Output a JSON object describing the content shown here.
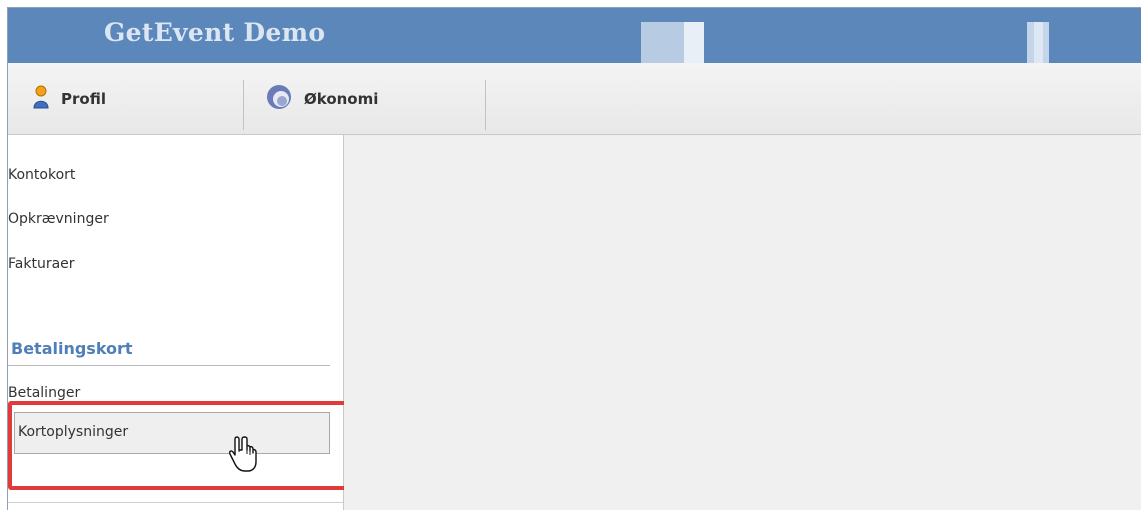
{
  "app": {
    "title": "GetEvent Demo"
  },
  "toolbar": {
    "tabs": [
      {
        "label": "Profil",
        "icon": "user-icon"
      },
      {
        "label": "Økonomi",
        "icon": "economy-icon"
      }
    ]
  },
  "sidebar": {
    "items": [
      {
        "label": "Kontokort"
      },
      {
        "label": "Opkrævninger"
      },
      {
        "label": "Fakturaer"
      }
    ],
    "section": {
      "heading": "Betalingskort",
      "items": [
        {
          "label": "Betalinger"
        },
        {
          "label": "Kortoplysninger"
        }
      ]
    }
  },
  "colors": {
    "titlebar": "#5c87bb",
    "section_heading": "#4f7fb8",
    "highlight": "#e03a3a"
  }
}
